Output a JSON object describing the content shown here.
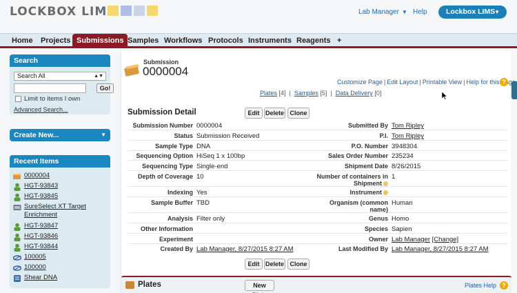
{
  "header": {
    "logo_text": "LOCKBOX LIMS",
    "user_menu": "Lab Manager",
    "help": "Help",
    "app_switcher": "Lockbox LIMS"
  },
  "tabs": [
    "Home",
    "Projects",
    "Submissions",
    "Samples",
    "Workflows",
    "Protocols",
    "Instruments",
    "Reagents",
    "+"
  ],
  "active_tab": "Submissions",
  "sidebar": {
    "search": {
      "title": "Search",
      "select_value": "Search All",
      "input_value": "",
      "go_label": "Go!",
      "limit_label": "Limit to items I own",
      "advanced_label": "Advanced Search..."
    },
    "create_new": {
      "title": "Create New..."
    },
    "recent": {
      "title": "Recent Items",
      "items": [
        {
          "label": "0000004",
          "icon": "book-icon"
        },
        {
          "label": "HGT-93843",
          "icon": "person-icon"
        },
        {
          "label": "HGT-93845",
          "icon": "person-icon"
        },
        {
          "label": "SureSelect XT Target Enrichment",
          "icon": "kit-icon"
        },
        {
          "label": "HGT-93847",
          "icon": "person-icon"
        },
        {
          "label": "HGT-93846",
          "icon": "person-icon"
        },
        {
          "label": "HGT-93844",
          "icon": "person-icon"
        },
        {
          "label": "100005",
          "icon": "dna-icon"
        },
        {
          "label": "100000",
          "icon": "dna-icon"
        },
        {
          "label": "Shear DNA",
          "icon": "protocol-icon"
        }
      ]
    }
  },
  "record": {
    "type_label": "Submission",
    "number": "0000004"
  },
  "util_links": [
    "Customize Page",
    "Edit Layout",
    "Printable View",
    "Help for this Page"
  ],
  "related_links": [
    {
      "label": "Plates",
      "count": "[4]"
    },
    {
      "label": "Samples",
      "count": "[5]"
    },
    {
      "label": "Data Delivery",
      "count": "[0]"
    }
  ],
  "detail": {
    "title": "Submission Detail",
    "buttons": [
      "Edit",
      "Delete",
      "Clone"
    ],
    "rows": [
      {
        "l1": "Submission Number",
        "v1": "0000004",
        "l2": "Submitted By",
        "v2": "Tom Ripley"
      },
      {
        "l1": "Status",
        "v1": "Submission Received",
        "l2": "P.I.",
        "v2": "Tom Ripley"
      },
      {
        "l1": "Sample Type",
        "v1": "DNA",
        "l2": "P.O. Number",
        "v2": "3948304"
      },
      {
        "l1": "Sequencing Option",
        "v1": "HiSeq 1 x 100bp",
        "l2": "Sales Order Number",
        "v2": "235234"
      },
      {
        "l1": "Sequencing Type",
        "v1": "Single-end",
        "l2": "Shipment Date",
        "v2": "8/26/2015"
      },
      {
        "l1": "Depth of Coverage",
        "v1": "10",
        "l2a": "Number of containers in",
        "l2b": "Shipment",
        "v2": "1"
      },
      {
        "l1": "Indexing",
        "v1": "Yes",
        "l2": "Instrument",
        "v2": ""
      },
      {
        "l1": "Sample Buffer",
        "v1": "TBD",
        "l2a": "Organism (common",
        "l2b": "name)",
        "v2": "Human"
      },
      {
        "l1": "Analysis",
        "v1": "Filter only",
        "l2": "Genus",
        "v2": "Homo"
      },
      {
        "l1": "Other Information",
        "v1": "",
        "l2": "Species",
        "v2": "Sapien"
      },
      {
        "l1": "Experiment",
        "v1": "",
        "l2": "Owner",
        "v2": "Lab Manager",
        "v2b": "[Change]"
      },
      {
        "l1": "Created By",
        "v1": "Lab Manager, 8/27/2015 8:27 AM",
        "l2": "Last Modified By",
        "v2": "Lab Manager, 8/27/2015 8:27 AM"
      }
    ]
  },
  "plates": {
    "title": "Plates",
    "new_button": "New Plate",
    "help": "Plates Help"
  },
  "colors": {
    "brand_blue": "#1b87c1",
    "tab_active": "#8c1a24",
    "link": "#1a5ea8",
    "logo_squares": [
      "#f6d66f",
      "#aebfe3",
      "#c9d3ea",
      "#f6d66f"
    ]
  }
}
